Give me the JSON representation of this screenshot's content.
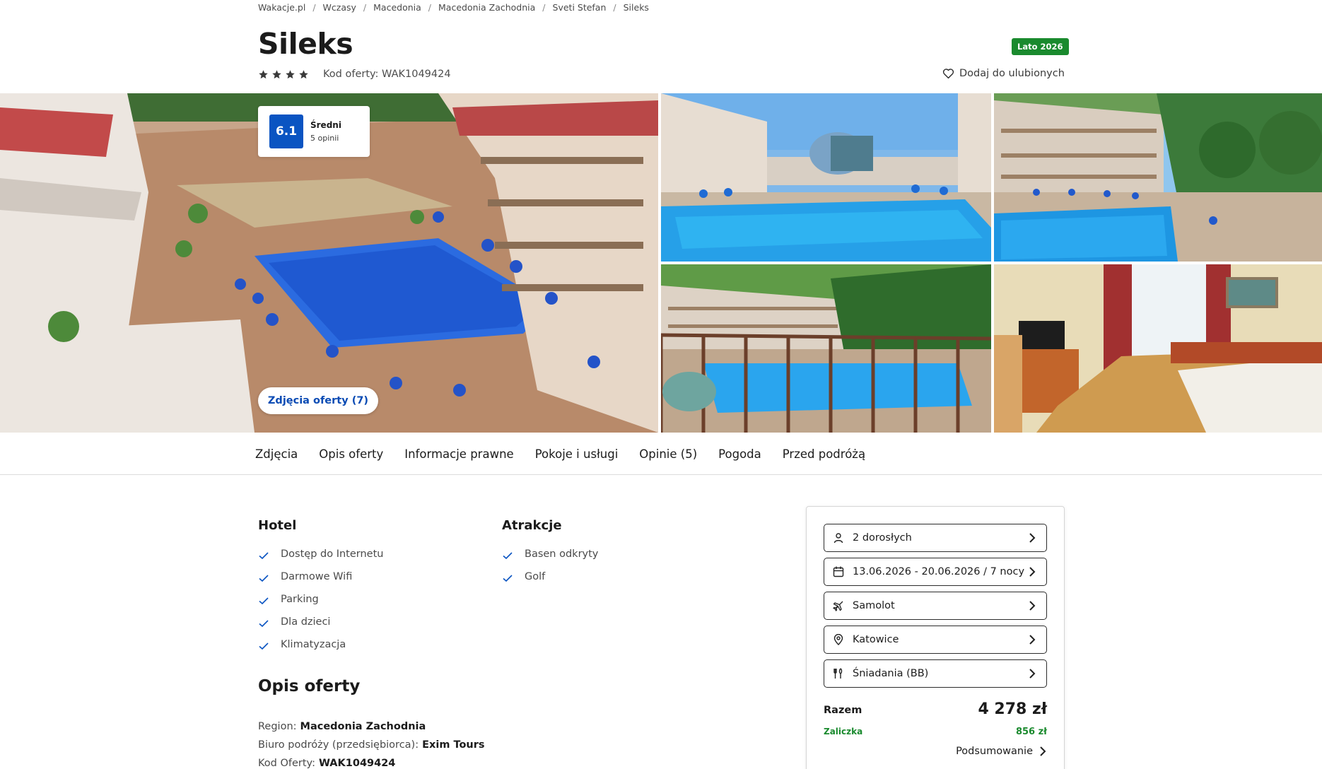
{
  "breadcrumb": [
    "Wakacje.pl",
    "Wczasy",
    "Macedonia",
    "Macedonia Zachodnia",
    "Sveti Stefan",
    "Sileks"
  ],
  "hotel": {
    "name": "Sileks",
    "stars": 4,
    "offer_code": "Kod oferty: WAK1049424",
    "season_badge": "Lato 2026",
    "favorite_label": "Dodaj do ulubionych"
  },
  "rating": {
    "score": "6.1",
    "label": "Średni",
    "count": "5 opinii"
  },
  "gallery": {
    "photos_button": "Zdjęcia oferty (7)",
    "photo_count": 5
  },
  "tabs": [
    "Zdjęcia",
    "Opis oferty",
    "Informacje prawne",
    "Pokoje i usługi",
    "Opinie (5)",
    "Pogoda",
    "Przed podróżą"
  ],
  "amenities": {
    "hotel": {
      "title": "Hotel",
      "items": [
        "Dostęp do Internetu",
        "Darmowe Wifi",
        "Parking",
        "Dla dzieci",
        "Klimatyzacja"
      ]
    },
    "attractions": {
      "title": "Atrakcje",
      "items": [
        "Basen odkryty",
        "Golf"
      ]
    }
  },
  "description": {
    "title": "Opis oferty",
    "region_label": "Region:",
    "region_value": "Macedonia Zachodnia",
    "agency_label": "Biuro podróży (przedsiębiorca):",
    "agency_value": "Exim Tours",
    "code_label": "Kod Oferty:",
    "code_value": "WAK1049424"
  },
  "booking": {
    "travelers": "2 dorosłych",
    "dates": "13.06.2026 - 20.06.2026 / 7 nocy",
    "transport": "Samolot",
    "departure": "Katowice",
    "board": "Śniadania (BB)",
    "total_label": "Razem",
    "total_price": "4 278 zł",
    "deposit_label": "Zaliczka",
    "deposit_price": "856 zł",
    "summary_label": "Podsumowanie"
  },
  "colors": {
    "accent_blue": "#0a54c2",
    "badge_green": "#1a8a2e",
    "star": "#3a3a3a"
  },
  "icons": {
    "travelers": "person-icon",
    "dates": "calendar-icon",
    "transport": "airplane-icon",
    "departure": "location-pin-icon",
    "board": "cutlery-icon",
    "amenity_check": "check-icon",
    "favorite": "heart-icon"
  }
}
